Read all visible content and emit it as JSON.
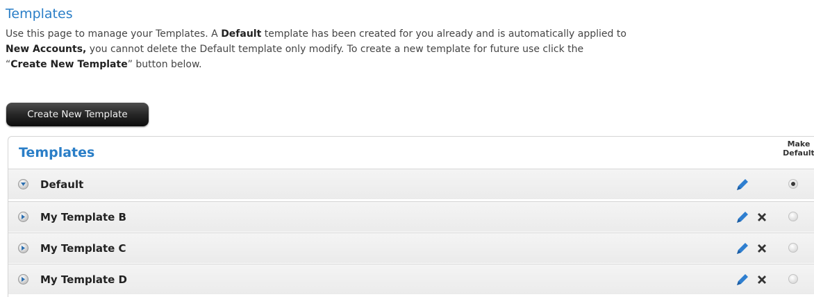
{
  "page": {
    "title": "Templates",
    "intro": {
      "p1": "Use this page to manage your Templates. A ",
      "b1": "Default",
      "p2": " template has been created for you already and is automatically applied to ",
      "b2": "New Accounts,",
      "p3": " you cannot delete the Default template only modify. To create a new template for future use click the ",
      "q1": "“",
      "b3": "Create New Template",
      "q2": "”",
      "p4": " button below."
    },
    "create_button_label": "Create New Template"
  },
  "panel": {
    "title": "Templates",
    "column_header": [
      "Make",
      "Default"
    ],
    "rows": [
      {
        "name": "Default",
        "expanded": true,
        "can_edit": true,
        "can_delete": false,
        "is_default": true
      },
      {
        "name": "My Template B",
        "expanded": false,
        "can_edit": true,
        "can_delete": true,
        "is_default": false
      },
      {
        "name": "My Template C",
        "expanded": false,
        "can_edit": true,
        "can_delete": true,
        "is_default": false
      },
      {
        "name": "My Template D",
        "expanded": false,
        "can_edit": true,
        "can_delete": true,
        "is_default": false
      }
    ]
  },
  "icons": {
    "expand": "expand-toggle-icon",
    "edit": "pencil-icon",
    "delete": "delete-x-icon",
    "default": "radio-button"
  },
  "colors": {
    "heading": "#2a7ec7",
    "pencil": "#2f7fd0",
    "delete": "#333333",
    "button_bg": "#1f1f1f"
  }
}
